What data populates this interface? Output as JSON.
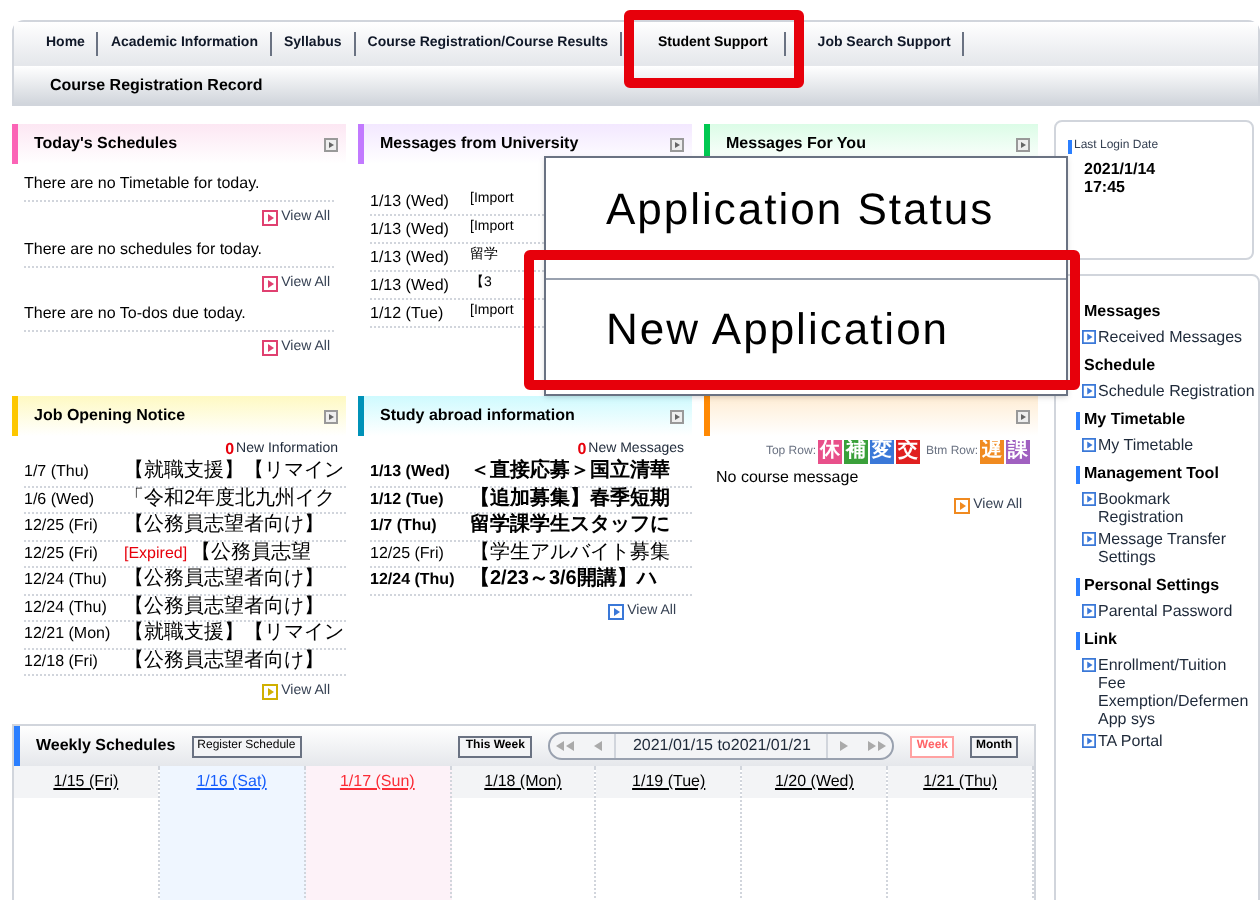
{
  "nav": {
    "items": [
      {
        "label": "Home",
        "selected": false
      },
      {
        "label": "Academic Information",
        "selected": false
      },
      {
        "label": "Syllabus",
        "selected": false
      },
      {
        "label": "Course Registration/Course Results",
        "selected": false
      },
      {
        "label": "Student Support",
        "selected": true
      },
      {
        "label": "Job Search Support",
        "selected": false
      }
    ],
    "subitems": [
      "Course Registration Record"
    ]
  },
  "todays_schedules": {
    "title": "Today's Schedules",
    "sections": [
      {
        "text": "There are no Timetable for today.",
        "link": "View All"
      },
      {
        "text": "There are no schedules for today.",
        "link": "View All"
      },
      {
        "text": "There are no To-dos due today.",
        "link": "View All"
      }
    ]
  },
  "messages_from_university": {
    "title": "Messages from University",
    "rows": [
      {
        "date": "1/13 (Wed)",
        "subject": "[Import"
      },
      {
        "date": "1/13 (Wed)",
        "subject": "[Import"
      },
      {
        "date": "1/13 (Wed)",
        "subject": "留学"
      },
      {
        "date": "1/13 (Wed)",
        "subject": "【3"
      },
      {
        "date": "1/12 (Tue)",
        "subject": "[Import"
      }
    ]
  },
  "messages_for_you": {
    "title": "Messages For You"
  },
  "popup_menu": {
    "items": [
      {
        "label": "Application Status",
        "highlighted": false
      },
      {
        "label": "New Application",
        "highlighted": true
      }
    ]
  },
  "job_opening_notice": {
    "title": "Job Opening Notice",
    "new_count": "0",
    "new_label": "New Information",
    "link": "View All",
    "rows": [
      {
        "date": "1/7 (Thu)",
        "subject": "【就職支援】【リマイン"
      },
      {
        "date": "1/6 (Wed)",
        "subject": "「令和2年度北九州イク"
      },
      {
        "date": "12/25 (Fri)",
        "subject": "【公務員志望者向け】"
      },
      {
        "date": "12/25 (Fri)",
        "tag": "[Expired]",
        "subject": "【公務員志望"
      },
      {
        "date": "12/24 (Thu)",
        "subject": "【公務員志望者向け】"
      },
      {
        "date": "12/24 (Thu)",
        "subject": "【公務員志望者向け】"
      },
      {
        "date": "12/21 (Mon)",
        "subject": "【就職支援】【リマイン"
      },
      {
        "date": "12/18 (Fri)",
        "subject": "【公務員志望者向け】"
      }
    ]
  },
  "study_abroad": {
    "title": "Study abroad information",
    "new_count": "0",
    "new_label": "New Messages",
    "link": "View All",
    "rows": [
      {
        "date": "1/13 (Wed)",
        "subject": "＜直接応募＞国立清華",
        "unread": true
      },
      {
        "date": "1/12 (Tue)",
        "subject": "【追加募集】春季短期",
        "unread": true
      },
      {
        "date": "1/7 (Thu)",
        "subject": "留学課学生スタッフに",
        "unread": true
      },
      {
        "date": "12/25 (Fri)",
        "subject": "【学生アルバイト募集",
        "unread": false
      },
      {
        "date": "12/24 (Thu)",
        "subject": "【2/23～3/6開講】ハ",
        "unread": true
      }
    ]
  },
  "course_messages": {
    "top_row_label": "Top Row:",
    "top_badges": [
      {
        "label": "休",
        "color": "#e8508a"
      },
      {
        "label": "補",
        "color": "#3aa03a"
      },
      {
        "label": "変",
        "color": "#3a78d8"
      },
      {
        "label": "交",
        "color": "#e02020"
      }
    ],
    "btm_row_label": "Btm Row:",
    "btm_badges": [
      {
        "label": "遅",
        "color": "#f08a20"
      },
      {
        "label": "課",
        "color": "#a060c0"
      }
    ],
    "text": "No course message",
    "link": "View All"
  },
  "last_login": {
    "label": "Last Login Date",
    "date": "2021/1/14",
    "time": "17:45"
  },
  "sidebar": {
    "sections": [
      {
        "title": "Messages",
        "items": [
          "Received Messages"
        ]
      },
      {
        "title": "Schedule",
        "items": [
          "Schedule Registration"
        ]
      },
      {
        "title": "My Timetable",
        "items": [
          "My Timetable"
        ]
      },
      {
        "title": "Management Tool",
        "items": [
          "Bookmark Registration",
          "Message Transfer Settings"
        ]
      },
      {
        "title": "Personal Settings",
        "items": [
          "Parental Password"
        ]
      },
      {
        "title": "Link",
        "items": [
          "Enrollment/Tuition Fee Exemption/Defermen App sys",
          "TA Portal"
        ]
      }
    ]
  },
  "weekly_schedules": {
    "title": "Weekly Schedules",
    "register_button": "Register Schedule",
    "this_week_button": "This Week",
    "range": "2021/01/15 to2021/01/21",
    "views": [
      {
        "label": "Week",
        "selected": true
      },
      {
        "label": "Month",
        "selected": false
      }
    ],
    "days": [
      {
        "label": "1/15 (Fri)",
        "kind": "weekday"
      },
      {
        "label": "1/16 (Sat)",
        "kind": "saturday"
      },
      {
        "label": "1/17 (Sun)",
        "kind": "sunday"
      },
      {
        "label": "1/18 (Mon)",
        "kind": "weekday"
      },
      {
        "label": "1/19 (Tue)",
        "kind": "weekday"
      },
      {
        "label": "1/20 (Wed)",
        "kind": "weekday"
      },
      {
        "label": "1/21 (Thu)",
        "kind": "weekday"
      }
    ]
  }
}
